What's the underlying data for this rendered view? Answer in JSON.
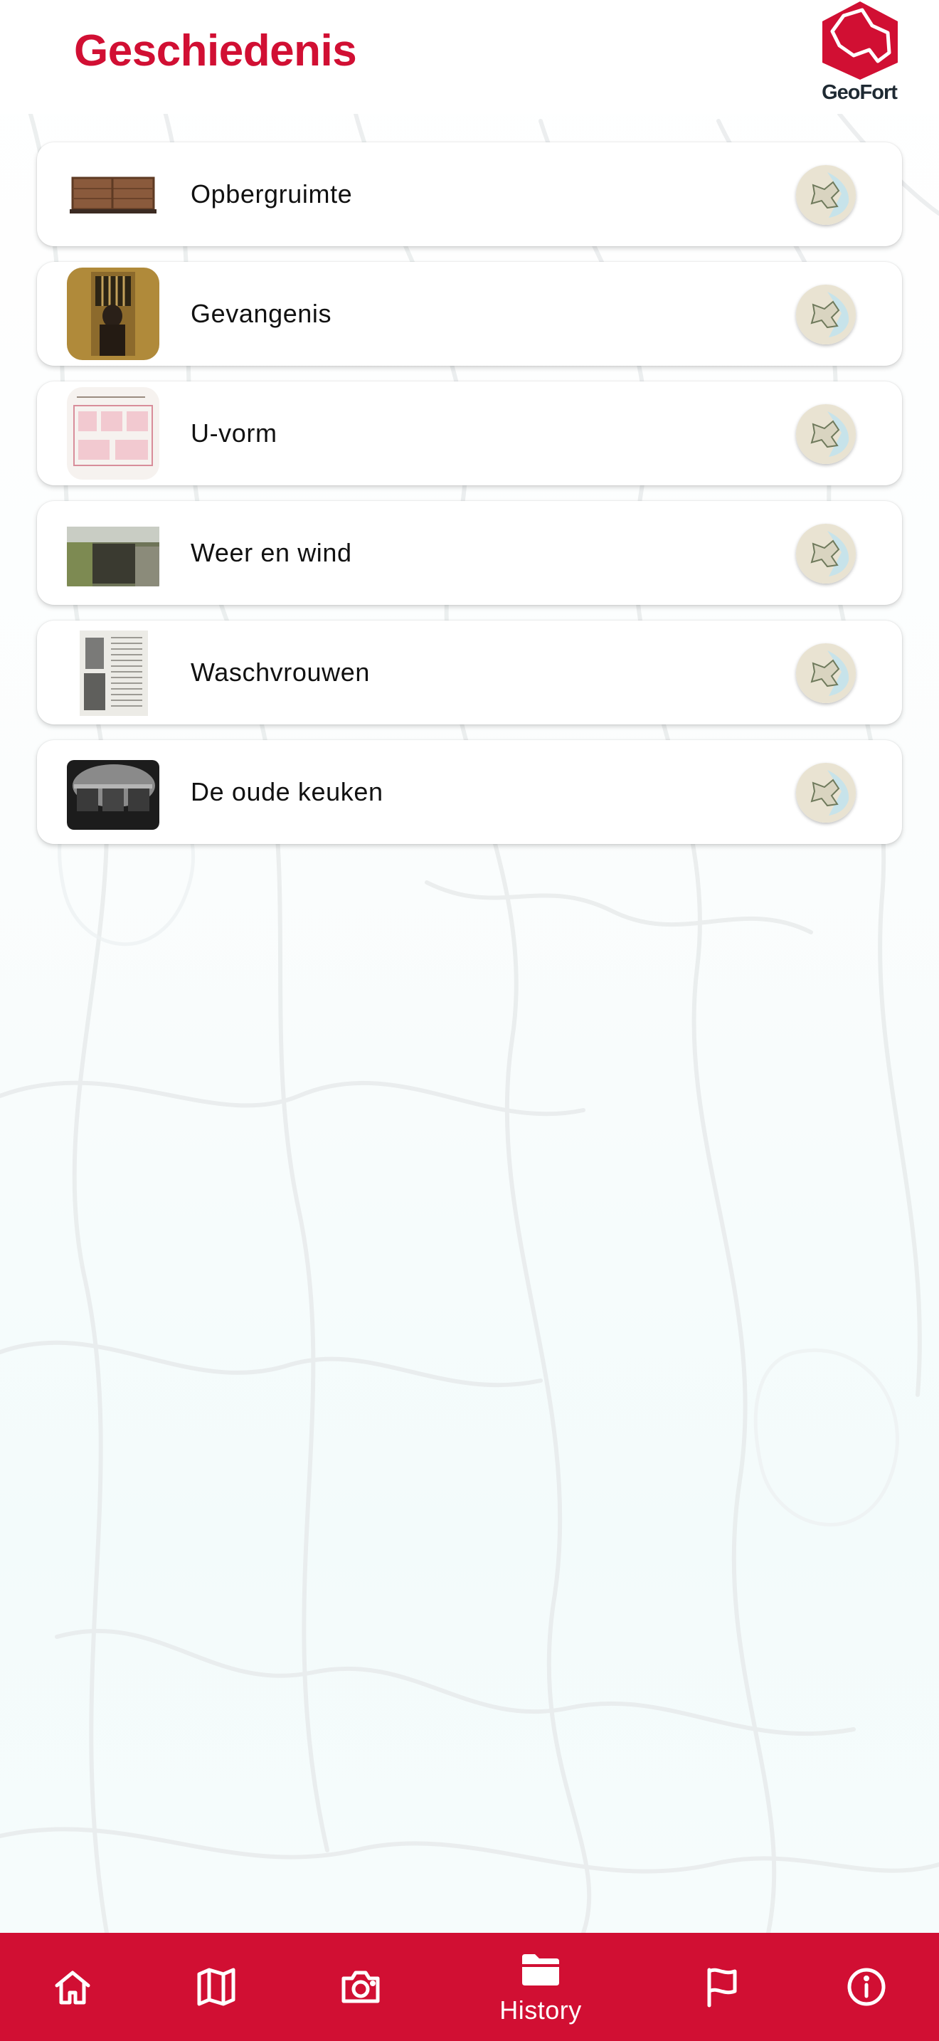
{
  "header": {
    "title": "Geschiedenis",
    "logo_text": "GeoFort"
  },
  "history_items": [
    {
      "title": "Opbergruimte",
      "thumb_icon": "storage-crate-photo"
    },
    {
      "title": "Gevangenis",
      "thumb_icon": "prison-cell-photo"
    },
    {
      "title": "U-vorm",
      "thumb_icon": "floor-plan-drawing"
    },
    {
      "title": "Weer en wind",
      "thumb_icon": "fort-wall-photo"
    },
    {
      "title": "Waschvrouwen",
      "thumb_icon": "old-document-page"
    },
    {
      "title": "De oude keuken",
      "thumb_icon": "old-kitchen-photo"
    }
  ],
  "bottom_nav": {
    "items": [
      {
        "icon": "home-icon"
      },
      {
        "icon": "map-icon"
      },
      {
        "icon": "camera-icon"
      },
      {
        "icon": "folder-icon",
        "label": "History",
        "active": true
      },
      {
        "icon": "flag-icon"
      },
      {
        "icon": "info-icon"
      }
    ]
  },
  "colors": {
    "brand_red": "#d10f33",
    "title_text": "#111111",
    "background": "#ffffff"
  }
}
